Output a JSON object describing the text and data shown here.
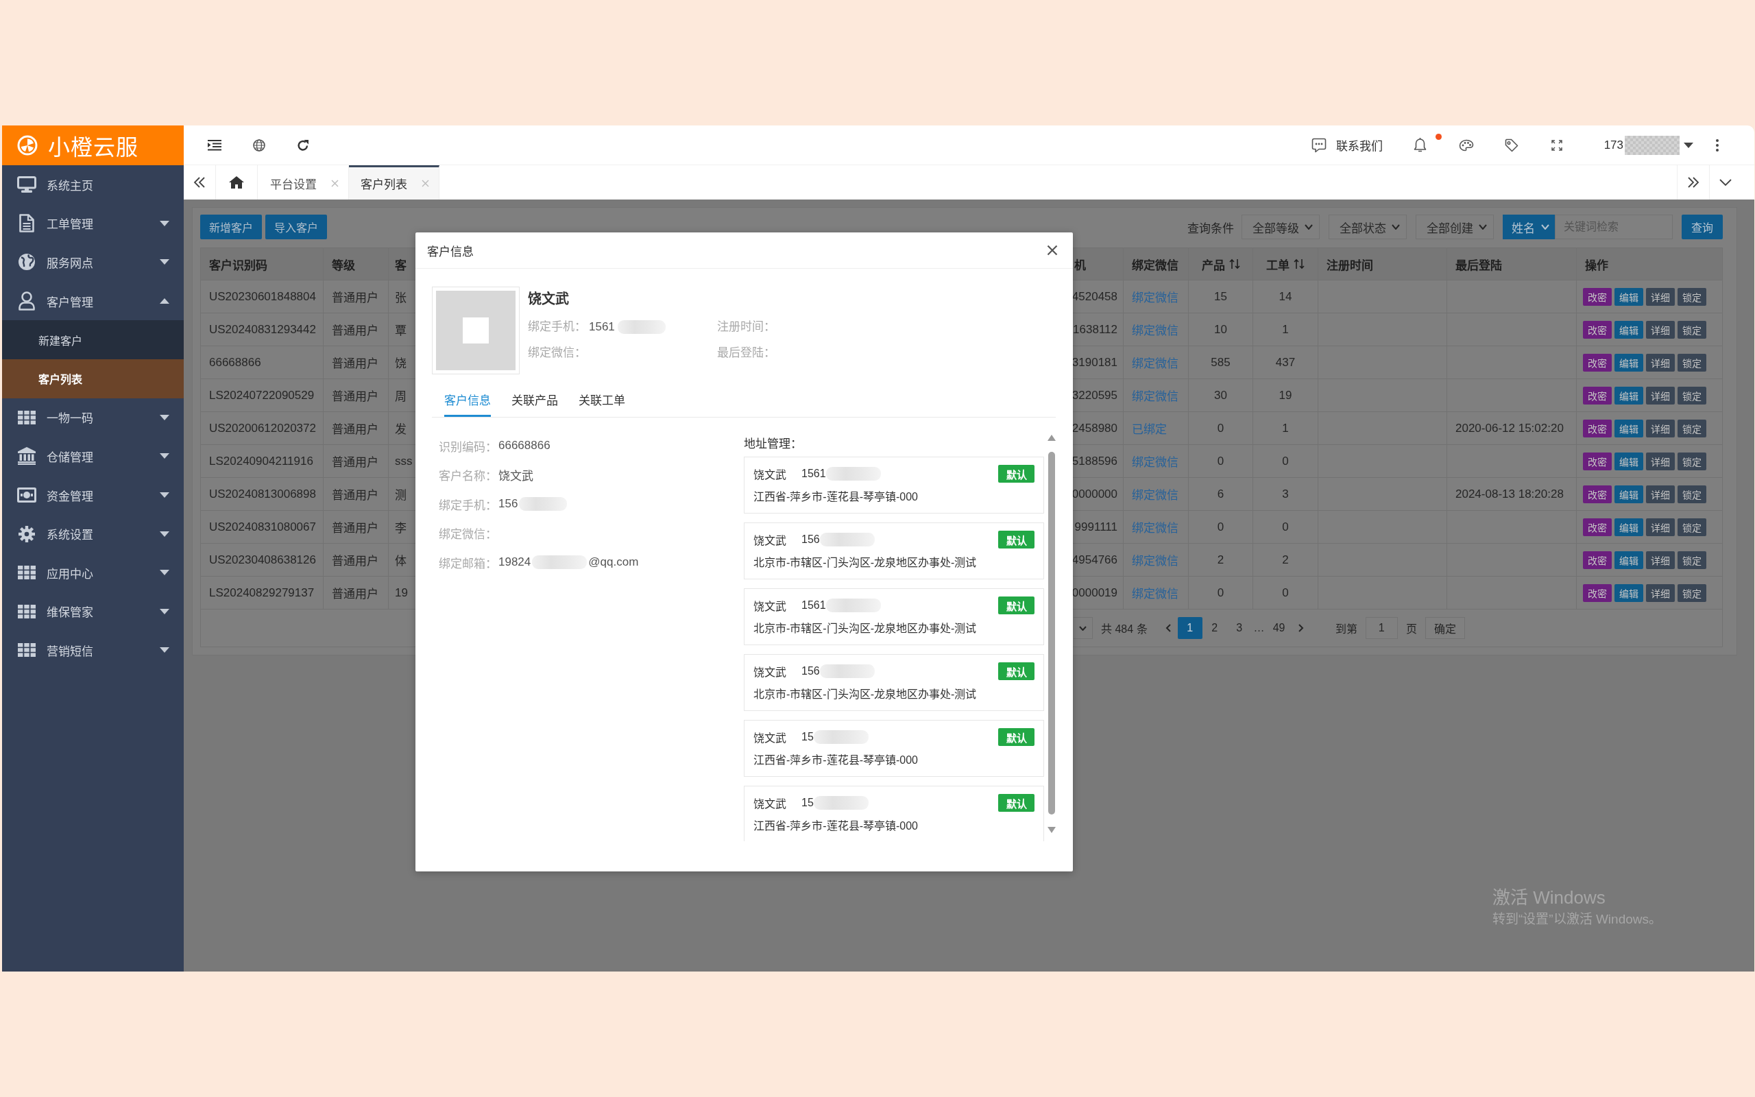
{
  "sidebar": {
    "logo": "小橙云服",
    "items": [
      {
        "kind": "page",
        "label": "系统主页"
      },
      {
        "kind": "group",
        "label": "工单管理",
        "expanded": false
      },
      {
        "kind": "group",
        "label": "服务网点",
        "expanded": false
      },
      {
        "kind": "group",
        "label": "客户管理",
        "expanded": true,
        "children": [
          {
            "label": "新建客户",
            "selected": false
          },
          {
            "label": "客户列表",
            "selected": true
          }
        ]
      },
      {
        "kind": "group",
        "label": "一物一码",
        "expanded": false
      },
      {
        "kind": "group",
        "label": "仓储管理",
        "expanded": false
      },
      {
        "kind": "group",
        "label": "资金管理",
        "expanded": false
      },
      {
        "kind": "group",
        "label": "系统设置",
        "expanded": false
      },
      {
        "kind": "group",
        "label": "应用中心",
        "expanded": false
      },
      {
        "kind": "group",
        "label": "维保管家",
        "expanded": false
      },
      {
        "kind": "group",
        "label": "营销短信",
        "expanded": false
      }
    ]
  },
  "header": {
    "contact": "联系我们",
    "unread": true,
    "user": "173",
    "user_masked": true
  },
  "tabs": [
    {
      "label": "平台设置",
      "selected": false
    },
    {
      "label": "客户列表",
      "selected": true
    }
  ],
  "toolbar": {
    "buttons": [
      "新增客户",
      "导入客户"
    ],
    "filter_label": "查询条件",
    "filters": [
      "全部等级",
      "全部状态",
      "全部创建"
    ],
    "field": "姓名",
    "search": {
      "placeholder": "关键词检索"
    },
    "search_button": "查询"
  },
  "table": {
    "columns": [
      {
        "label": "客户识别码",
        "sortable": false
      },
      {
        "label": "等级",
        "sortable": false
      },
      {
        "label": "客",
        "sortable": false
      },
      {
        "label": "机",
        "sortable": false
      },
      {
        "label": "绑定微信",
        "sortable": false
      },
      {
        "label": "产品",
        "sortable": true
      },
      {
        "label": "工单",
        "sortable": true
      },
      {
        "label": "注册时间",
        "sortable": false
      },
      {
        "label": "最后登陆",
        "sortable": false
      },
      {
        "label": "操作",
        "sortable": false
      }
    ],
    "rows": [
      {
        "id_code": "US20230601848804",
        "grade": "普通用户",
        "column_3": "张",
        "column_4": "4520458",
        "wechat": "绑定微信",
        "products": "15",
        "orders": "14",
        "actions": [
          {
            "label": "改密",
            "color": "#6b1f7e"
          },
          {
            "label": "编辑",
            "color": "#0f5b89"
          },
          {
            "label": "详细",
            "color": "#3a4655"
          },
          {
            "label": "锁定",
            "color": "#3a4655"
          }
        ]
      },
      {
        "id_code": "US20240831293442",
        "grade": "普通用户",
        "column_3": "覃",
        "column_4": "1638112",
        "wechat": "绑定微信",
        "products": "10",
        "orders": "1",
        "actions": [
          {
            "label": "改密",
            "color": "#6b1f7e"
          },
          {
            "label": "编辑",
            "color": "#0f5b89"
          },
          {
            "label": "详细",
            "color": "#3a4655"
          },
          {
            "label": "锁定",
            "color": "#3a4655"
          }
        ]
      },
      {
        "id_code": "66668866",
        "grade": "普通用户",
        "column_3": "饶",
        "column_4": "3190181",
        "wechat": "绑定微信",
        "products": "585",
        "orders": "437",
        "actions": [
          {
            "label": "改密",
            "color": "#6b1f7e"
          },
          {
            "label": "编辑",
            "color": "#0f5b89"
          },
          {
            "label": "详细",
            "color": "#3a4655"
          },
          {
            "label": "锁定",
            "color": "#3a4655"
          }
        ]
      },
      {
        "id_code": "LS20240722090529",
        "grade": "普通用户",
        "column_3": "周",
        "column_4": "3220595",
        "wechat": "绑定微信",
        "products": "30",
        "orders": "19",
        "actions": [
          {
            "label": "改密",
            "color": "#6b1f7e"
          },
          {
            "label": "编辑",
            "color": "#0f5b89"
          },
          {
            "label": "详细",
            "color": "#3a4655"
          },
          {
            "label": "锁定",
            "color": "#3a4655"
          }
        ]
      },
      {
        "id_code": "US20200612020372",
        "grade": "普通用户",
        "column_3": "发",
        "column_4": "2458980",
        "wechat": "已绑定",
        "products": "0",
        "orders": "1",
        "last_login": "2020-06-12 15:02:20",
        "actions": [
          {
            "label": "改密",
            "color": "#6b1f7e"
          },
          {
            "label": "编辑",
            "color": "#0f5b89"
          },
          {
            "label": "详细",
            "color": "#3a4655"
          },
          {
            "label": "锁定",
            "color": "#3a4655"
          }
        ]
      },
      {
        "id_code": "LS20240904211916",
        "grade": "普通用户",
        "column_3": "sss",
        "column_4": "5188596",
        "wechat": "绑定微信",
        "products": "0",
        "orders": "0",
        "actions": [
          {
            "label": "改密",
            "color": "#6b1f7e"
          },
          {
            "label": "编辑",
            "color": "#0f5b89"
          },
          {
            "label": "详细",
            "color": "#3a4655"
          },
          {
            "label": "锁定",
            "color": "#3a4655"
          }
        ]
      },
      {
        "id_code": "US20240813006898",
        "grade": "普通用户",
        "column_3": "测",
        "column_4": "0000000",
        "wechat": "绑定微信",
        "products": "6",
        "orders": "3",
        "last_login": "2024-08-13 18:20:28",
        "actions": [
          {
            "label": "改密",
            "color": "#6b1f7e"
          },
          {
            "label": "编辑",
            "color": "#0f5b89"
          },
          {
            "label": "详细",
            "color": "#3a4655"
          },
          {
            "label": "锁定",
            "color": "#3a4655"
          }
        ]
      },
      {
        "id_code": "US20240831080067",
        "grade": "普通用户",
        "column_3": "李",
        "column_4": "9991111",
        "wechat": "绑定微信",
        "products": "0",
        "orders": "0",
        "actions": [
          {
            "label": "改密",
            "color": "#6b1f7e"
          },
          {
            "label": "编辑",
            "color": "#0f5b89"
          },
          {
            "label": "详细",
            "color": "#3a4655"
          },
          {
            "label": "锁定",
            "color": "#3a4655"
          }
        ]
      },
      {
        "id_code": "US20230408638126",
        "grade": "普通用户",
        "column_3": "体",
        "column_4": "4954766",
        "wechat": "绑定微信",
        "products": "2",
        "orders": "2",
        "actions": [
          {
            "label": "改密",
            "color": "#6b1f7e"
          },
          {
            "label": "编辑",
            "color": "#0f5b89"
          },
          {
            "label": "详细",
            "color": "#3a4655"
          },
          {
            "label": "锁定",
            "color": "#3a4655"
          }
        ]
      },
      {
        "id_code": "LS20240829279137",
        "grade": "普通用户",
        "column_3": "19",
        "column_4": "0000019",
        "wechat": "绑定微信",
        "products": "0",
        "orders": "0",
        "actions": [
          {
            "label": "改密",
            "color": "#6b1f7e"
          },
          {
            "label": "编辑",
            "color": "#0f5b89"
          },
          {
            "label": "详细",
            "color": "#3a4655"
          },
          {
            "label": "锁定",
            "color": "#3a4655"
          }
        ]
      }
    ]
  },
  "pagination": {
    "total": "共 484 条",
    "items": [
      {
        "kind": "page",
        "label": "1",
        "selected": true
      },
      {
        "kind": "page",
        "label": "2",
        "selected": false
      },
      {
        "kind": "page",
        "label": "3",
        "selected": false
      },
      {
        "kind": "gap",
        "label": "…"
      },
      {
        "kind": "page",
        "label": "49",
        "selected": false
      }
    ],
    "goto_label": "到第",
    "goto_value": "1",
    "goto_unit": "页",
    "confirm": "确定"
  },
  "dialog": {
    "title": "客户信息",
    "name": "饶文武",
    "profile_fields": [
      {
        "label": "绑定手机：",
        "value": "1561",
        "masked": true
      },
      {
        "label": "注册时间：",
        "masked": false
      },
      {
        "label": "绑定微信：",
        "masked": false
      },
      {
        "label": "最后登陆：",
        "masked": false
      }
    ],
    "tabs": [
      {
        "label": "客户信息",
        "selected": true
      },
      {
        "label": "关联产品",
        "selected": false
      },
      {
        "label": "关联工单",
        "selected": false
      }
    ],
    "info": [
      {
        "label": "识别编码：",
        "value": "66668866",
        "masked": false
      },
      {
        "label": "客户名称：",
        "value": "饶文武",
        "masked": false
      },
      {
        "label": "绑定手机：",
        "value": "156",
        "masked": true
      },
      {
        "label": "绑定微信：",
        "masked": false
      },
      {
        "label": "绑定邮箱：",
        "value": "19824",
        "masked": true,
        "suffix": "@qq.com"
      }
    ],
    "address_title": "地址管理：",
    "addresses": [
      {
        "name": "饶文武",
        "phone": "1561",
        "masked": true,
        "badge": "默认",
        "address": "江西省-萍乡市-莲花县-琴亭镇-000"
      },
      {
        "name": "饶文武",
        "phone": "156",
        "masked": true,
        "badge": "默认",
        "address": "北京市-市辖区-门头沟区-龙泉地区办事处-测试"
      },
      {
        "name": "饶文武",
        "phone": "1561",
        "masked": true,
        "badge": "默认",
        "address": "北京市-市辖区-门头沟区-龙泉地区办事处-测试"
      },
      {
        "name": "饶文武",
        "phone": "156",
        "masked": true,
        "badge": "默认",
        "address": "北京市-市辖区-门头沟区-龙泉地区办事处-测试"
      },
      {
        "name": "饶文武",
        "phone": "15",
        "masked": true,
        "badge": "默认",
        "address": "江西省-萍乡市-莲花县-琴亭镇-000"
      },
      {
        "name": "饶文武",
        "phone": "15",
        "masked": true,
        "badge": "默认",
        "address": "江西省-萍乡市-莲花县-琴亭镇-000"
      }
    ]
  },
  "activation_notice": {
    "title": "激活 Windows",
    "hint": "转到“设置”以激活 Windows。"
  }
}
